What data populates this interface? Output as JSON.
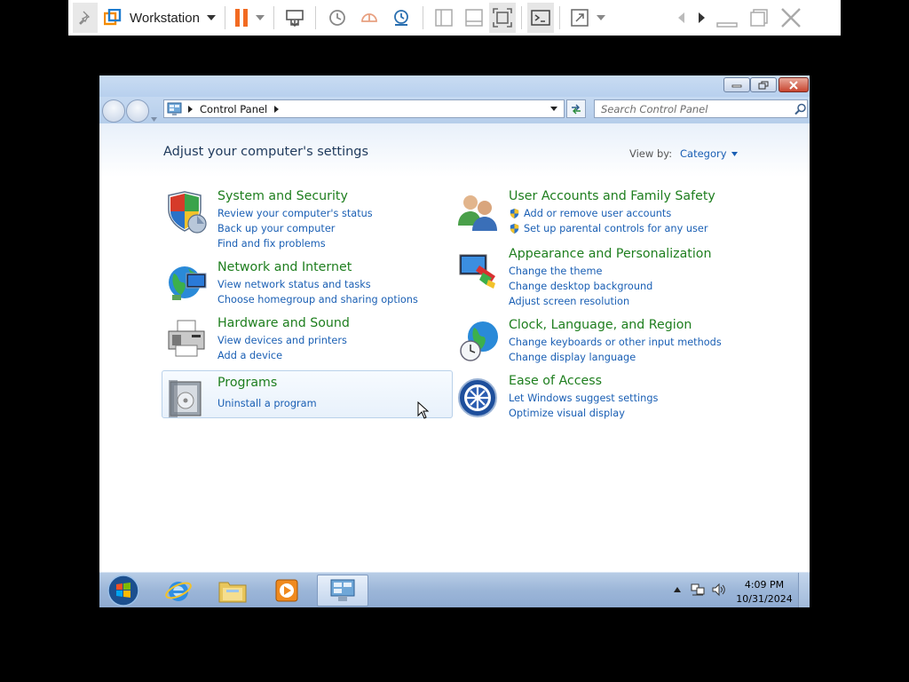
{
  "vmware": {
    "title": "Workstation",
    "icons": [
      "pin-icon",
      "vmware-logo-icon",
      "dropdown-icon",
      "pause-icon",
      "dropdown-icon",
      "send-keys-icon",
      "snapshot-icon",
      "revert-snapshot-icon",
      "snapshot-manager-icon",
      "library-view-icon",
      "thumbnail-view-icon",
      "fullscreen-icon",
      "console-icon",
      "stretch-icon",
      "dropdown-icon",
      "prev-icon",
      "next-icon",
      "minimize-icon",
      "restore-icon",
      "close-icon"
    ]
  },
  "window": {
    "breadcrumb": "Control Panel",
    "search_placeholder": "Search Control Panel"
  },
  "main": {
    "title": "Adjust your computer's settings",
    "viewby_label": "View by:",
    "viewby_value": "Category"
  },
  "categories": [
    {
      "title": "System and Security",
      "links": [
        "Review your computer's status",
        "Back up your computer",
        "Find and fix problems"
      ]
    },
    {
      "title": "Network and Internet",
      "links": [
        "View network status and tasks",
        "Choose homegroup and sharing options"
      ]
    },
    {
      "title": "Hardware and Sound",
      "links": [
        "View devices and printers",
        "Add a device"
      ]
    },
    {
      "title": "Programs",
      "links": [
        "Uninstall a program"
      ]
    },
    {
      "title": "User Accounts and Family Safety",
      "links": [
        "Add or remove user accounts",
        "Set up parental controls for any user"
      ]
    },
    {
      "title": "Appearance and Personalization",
      "links": [
        "Change the theme",
        "Change desktop background",
        "Adjust screen resolution"
      ]
    },
    {
      "title": "Clock, Language, and Region",
      "links": [
        "Change keyboards or other input methods",
        "Change display language"
      ]
    },
    {
      "title": "Ease of Access",
      "links": [
        "Let Windows suggest settings",
        "Optimize visual display"
      ]
    }
  ],
  "taskbar": {
    "time": "4:09 PM",
    "date": "10/31/2024"
  },
  "colors": {
    "category_title": "#1e7e1e",
    "link": "#1a5fb4",
    "page_title": "#1e395b"
  }
}
